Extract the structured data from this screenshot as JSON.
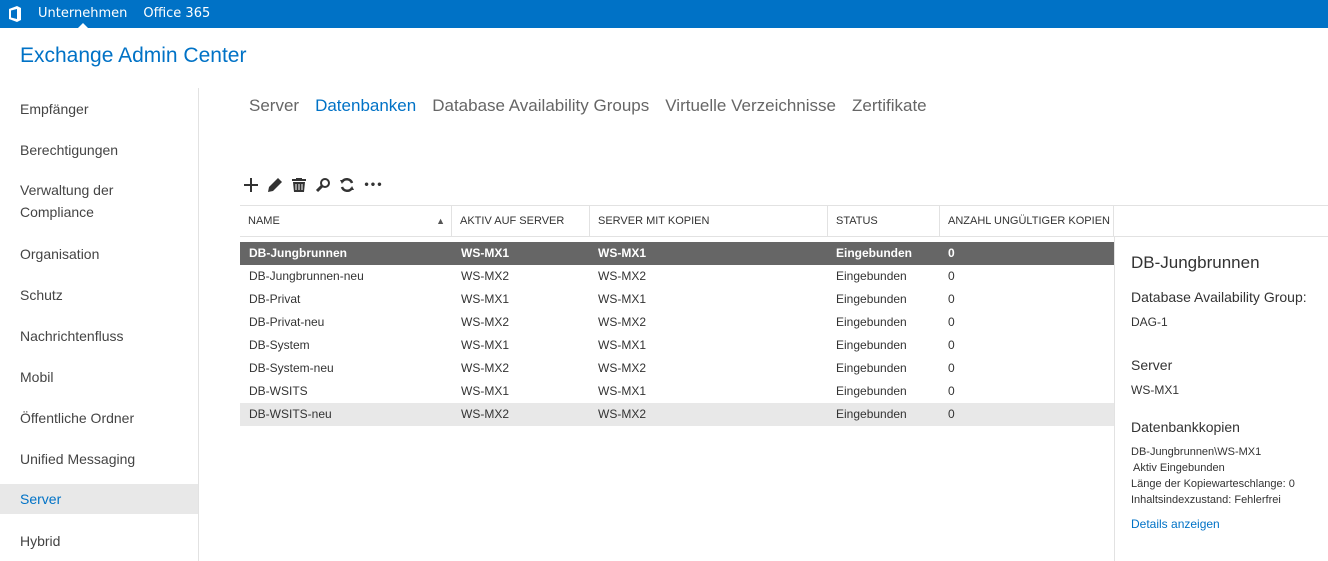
{
  "topbar": {
    "logo_icon": "office-logo-icon",
    "links": [
      "Unternehmen",
      "Office 365"
    ]
  },
  "app_title": "Exchange Admin Center",
  "sidebar": {
    "items": [
      {
        "label": "Empfänger"
      },
      {
        "label": "Berechtigungen"
      },
      {
        "label": "Verwaltung der Compliance"
      },
      {
        "label": "Organisation"
      },
      {
        "label": "Schutz"
      },
      {
        "label": "Nachrichtenfluss"
      },
      {
        "label": "Mobil"
      },
      {
        "label": "Öffentliche Ordner"
      },
      {
        "label": "Unified Messaging"
      },
      {
        "label": "Server"
      },
      {
        "label": "Hybrid"
      }
    ],
    "selected": "Server"
  },
  "tabs": [
    "Server",
    "Datenbanken",
    "Database Availability Groups",
    "Virtuelle Verzeichnisse",
    "Zertifikate"
  ],
  "active_tab": "Datenbanken",
  "toolbar": {
    "icons": [
      "add-icon",
      "edit-icon",
      "delete-icon",
      "search-icon",
      "refresh-icon",
      "more-icon"
    ],
    "more_label": "•••"
  },
  "table": {
    "columns": [
      "NAME",
      "AKTIV AUF SERVER",
      "SERVER MIT KOPIEN",
      "STATUS",
      "ANZAHL UNGÜLTIGER KOPIEN"
    ],
    "sort_indicator": "▲",
    "rows": [
      [
        "DB-Jungbrunnen",
        "WS-MX1",
        "WS-MX1",
        "Eingebunden",
        "0"
      ],
      [
        "DB-Jungbrunnen-neu",
        "WS-MX2",
        "WS-MX2",
        "Eingebunden",
        "0"
      ],
      [
        "DB-Privat",
        "WS-MX1",
        "WS-MX1",
        "Eingebunden",
        "0"
      ],
      [
        "DB-Privat-neu",
        "WS-MX2",
        "WS-MX2",
        "Eingebunden",
        "0"
      ],
      [
        "DB-System",
        "WS-MX1",
        "WS-MX1",
        "Eingebunden",
        "0"
      ],
      [
        "DB-System-neu",
        "WS-MX2",
        "WS-MX2",
        "Eingebunden",
        "0"
      ],
      [
        "DB-WSITS",
        "WS-MX1",
        "WS-MX1",
        "Eingebunden",
        "0"
      ],
      [
        "DB-WSITS-neu",
        "WS-MX2",
        "WS-MX2",
        "Eingebunden",
        "0"
      ]
    ],
    "selected_row": 0,
    "hover_row": 7
  },
  "details": {
    "title": "DB-Jungbrunnen",
    "dag_label": "Database Availability Group:",
    "dag_value": "DAG-1",
    "server_label": "Server",
    "server_value": "WS-MX1",
    "copies_label": "Datenbankkopien",
    "copy_name": "DB-Jungbrunnen\\WS-MX1",
    "copy_status": "Aktiv Eingebunden",
    "copy_queue": "Länge der Kopiewarteschlange: 0",
    "copy_index": "Inhaltsindexzustand: Fehlerfrei",
    "details_link": "Details anzeigen"
  },
  "colors": {
    "accent": "#0072c6",
    "selected_row": "#666666",
    "hover_row": "#e8e8e8"
  }
}
